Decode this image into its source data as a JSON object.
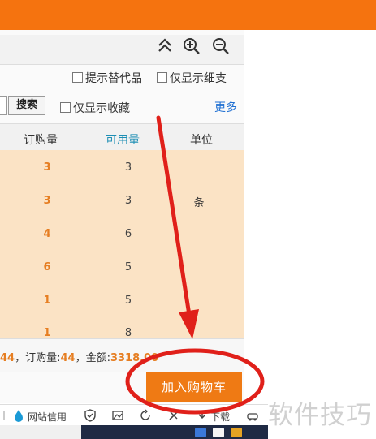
{
  "toolbar": {
    "options": [
      "提示替代品",
      "仅显示细支"
    ],
    "search_button": "搜索",
    "favorites_option": "仅显示收藏",
    "more_link": "更多"
  },
  "table": {
    "headers": [
      "订购量",
      "可用量",
      "单位"
    ],
    "rows": [
      {
        "qty": "3",
        "avail": "3"
      },
      {
        "qty": "3",
        "avail": "3"
      },
      {
        "qty": "4",
        "avail": "6"
      },
      {
        "qty": "6",
        "avail": "5"
      },
      {
        "qty": "1",
        "avail": "5"
      },
      {
        "qty": "1",
        "avail": "8"
      }
    ],
    "unit": "条"
  },
  "summary": {
    "count_value": "44",
    "qty_label": "，订购量:",
    "qty_value": "44",
    "amount_label": "，金额:",
    "amount_value": "3318.00"
  },
  "cart_button": "加入购物车",
  "statusbar": {
    "site_credit": "网站信用",
    "download": "下载"
  },
  "watermark": "软件技巧",
  "colors": {
    "brand_orange": "#f5730f",
    "row_bg": "#fbe3c5",
    "qty_color": "#e67e22",
    "avail_header": "#1e8fb5",
    "annotation_red": "#e0201a"
  }
}
